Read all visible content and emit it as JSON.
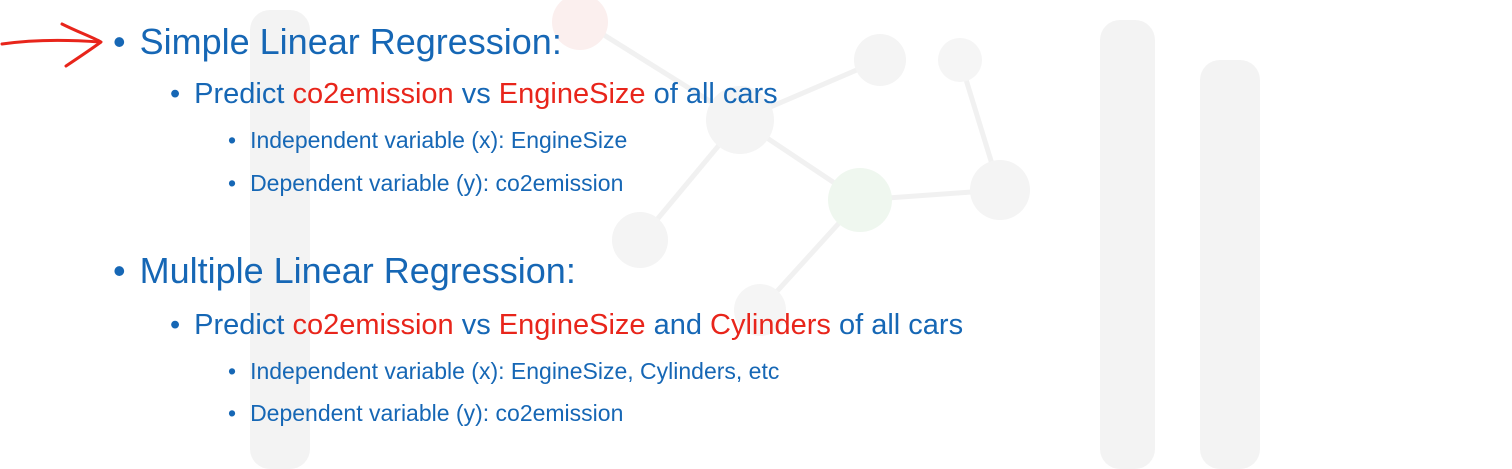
{
  "colors": {
    "text": "#1667b5",
    "highlight": "#e8251b",
    "annotation": "#e8251b"
  },
  "annotation_icon": "red-hand-drawn-arrow",
  "bullet_char": "•",
  "sections": [
    {
      "heading": "Simple Linear Regression:",
      "sub": {
        "prefix": "Predict",
        "target": "co2emission",
        "connector1": "vs",
        "feature1": "EngineSize",
        "suffix": "of all cars"
      },
      "details": [
        "Independent variable (x): EngineSize",
        "Dependent variable (y): co2emission"
      ]
    },
    {
      "heading": "Multiple Linear Regression:",
      "sub": {
        "prefix": "Predict",
        "target": "co2emission",
        "connector1": "vs",
        "feature1": "EngineSize",
        "connector2": "and",
        "feature2": "Cylinders",
        "suffix": "of all cars"
      },
      "details": [
        "Independent variable (x): EngineSize, Cylinders, etc",
        "Dependent variable (y): co2emission"
      ]
    }
  ]
}
